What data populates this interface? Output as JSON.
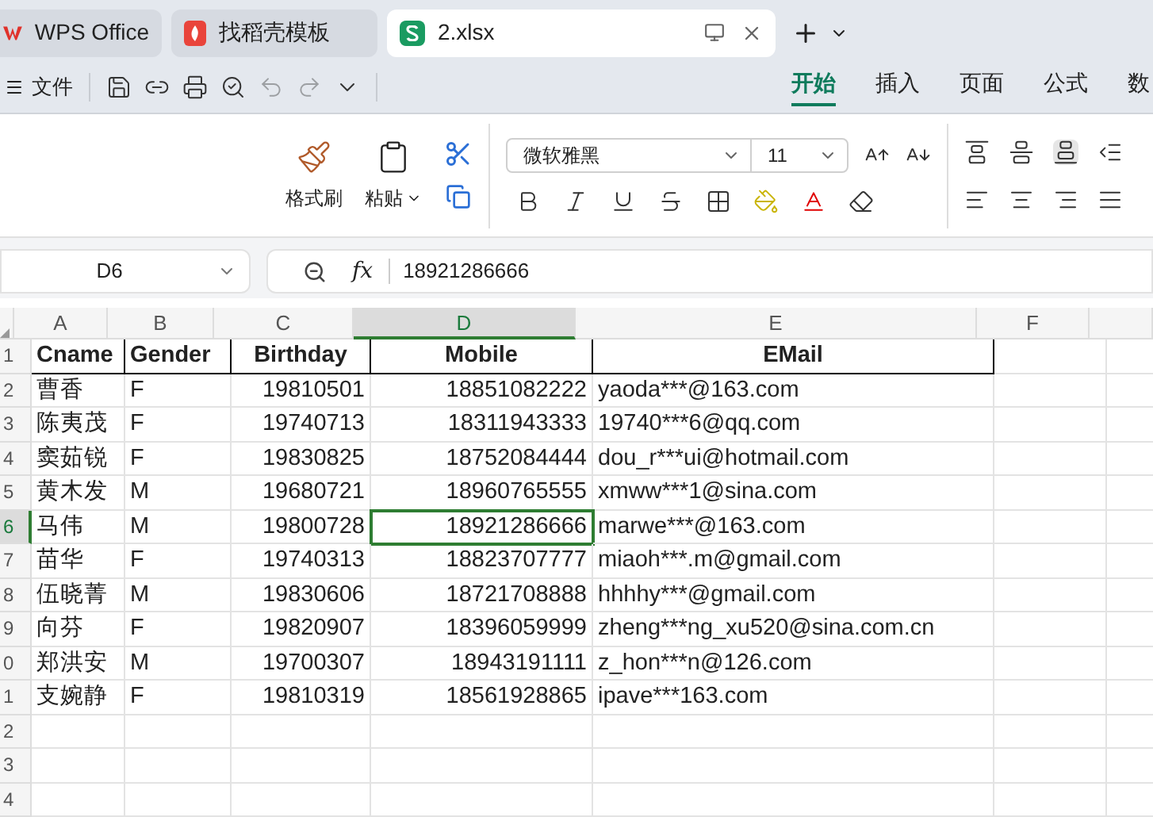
{
  "tabs": [
    {
      "label": "WPS Office",
      "kind": "wps",
      "selected": false
    },
    {
      "label": "找稻壳模板",
      "kind": "template",
      "selected": false
    },
    {
      "label": "2.xlsx",
      "kind": "sheet",
      "selected": true
    }
  ],
  "menu": {
    "label": "文件"
  },
  "ribbon_tabs": [
    {
      "label": "开始",
      "selected": true
    },
    {
      "label": "插入",
      "selected": false
    },
    {
      "label": "页面",
      "selected": false
    },
    {
      "label": "公式",
      "selected": false
    },
    {
      "label": "数",
      "selected": false
    }
  ],
  "ribbon": {
    "format_painter": "格式刷",
    "paste": "粘贴",
    "font": "微软雅黑",
    "font_size": "11"
  },
  "formula_bar": {
    "cell_ref": "D6",
    "fx": "fx",
    "value": "18921286666"
  },
  "columns": [
    {
      "label": "A",
      "selected": false
    },
    {
      "label": "B",
      "selected": false
    },
    {
      "label": "C",
      "selected": false
    },
    {
      "label": "D",
      "selected": true
    },
    {
      "label": "E",
      "selected": false
    },
    {
      "label": "F",
      "selected": false
    },
    {
      "selected": false
    }
  ],
  "rows": [
    {
      "number": "1",
      "kind": "header",
      "selected": false,
      "cells": [
        "Cname",
        "Gender",
        "Birthday",
        "Mobile",
        "EMail"
      ]
    },
    {
      "number": "2",
      "kind": "data",
      "selected": false,
      "cells": [
        "曹香",
        "F",
        "19810501",
        "18851082222",
        "yaoda***@163.com"
      ]
    },
    {
      "number": "3",
      "kind": "data",
      "selected": false,
      "cells": [
        "陈夷茂",
        "F",
        "19740713",
        "18311943333",
        "19740***6@qq.com"
      ]
    },
    {
      "number": "4",
      "kind": "data",
      "selected": false,
      "cells": [
        "窦茹锐",
        "F",
        "19830825",
        "18752084444",
        "dou_r***ui@hotmail.com"
      ]
    },
    {
      "number": "5",
      "kind": "data",
      "selected": false,
      "cells": [
        "黄木发",
        "M",
        "19680721",
        "18960765555",
        "xmww***1@sina.com"
      ]
    },
    {
      "number": "6",
      "kind": "data",
      "selected": true,
      "cells": [
        "马伟",
        "M",
        "19800728",
        "18921286666",
        "marwe***@163.com"
      ]
    },
    {
      "number": "7",
      "kind": "data",
      "selected": false,
      "cells": [
        "苗华",
        "F",
        "19740313",
        "18823707777",
        "miaoh***.m@gmail.com"
      ]
    },
    {
      "number": "8",
      "kind": "data",
      "selected": false,
      "cells": [
        "伍晓菁",
        "M",
        "19830606",
        "18721708888",
        "hhhhy***@gmail.com"
      ]
    },
    {
      "number": "9",
      "kind": "data",
      "selected": false,
      "cells": [
        "向芬",
        "F",
        "19820907",
        "18396059999",
        "zheng***ng_xu520@sina.com.cn"
      ]
    },
    {
      "number": "0",
      "kind": "data",
      "selected": false,
      "cells": [
        "郑洪安",
        "M",
        "19700307",
        "18943191111",
        "z_hon***n@126.com"
      ]
    },
    {
      "number": "1",
      "kind": "data",
      "selected": false,
      "cells": [
        "支婉静",
        "F",
        "19810319",
        "18561928865",
        "ipave***163.com"
      ]
    },
    {
      "number": "2",
      "kind": "data",
      "selected": false,
      "cells": []
    },
    {
      "number": "3",
      "kind": "data",
      "selected": false,
      "cells": []
    },
    {
      "number": "4",
      "kind": "data",
      "selected": false,
      "cells": []
    }
  ]
}
